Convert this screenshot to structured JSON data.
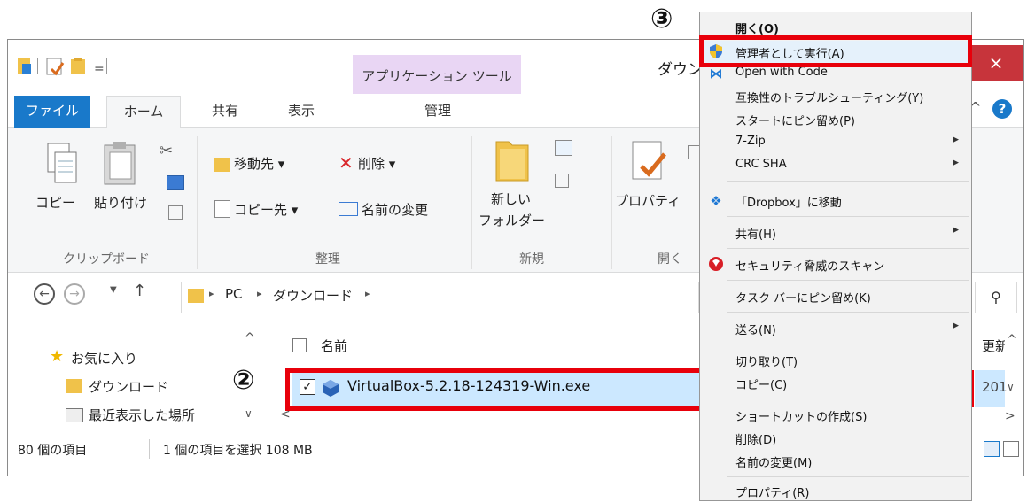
{
  "window": {
    "title": "ダウン",
    "context_tab": "アプリケーション ツール",
    "close": "×"
  },
  "tabs": {
    "file": "ファイル",
    "home": "ホーム",
    "share": "共有",
    "view": "表示",
    "manage": "管理"
  },
  "ribbon": {
    "clipboard": {
      "copy": "コピー",
      "paste": "貼り付け",
      "label": "クリップボード"
    },
    "organize": {
      "move_to": "移動先 ▾",
      "copy_to": "コピー先 ▾",
      "delete": "削除 ▾",
      "rename": "名前の変更",
      "label": "整理"
    },
    "new": {
      "new_folder_1": "新しい",
      "new_folder_2": "フォルダー",
      "label": "新規"
    },
    "open": {
      "properties": "プロパティ",
      "label": "開く"
    }
  },
  "address": {
    "pc": "PC",
    "downloads": "ダウンロード",
    "sep": "▸"
  },
  "nav": {
    "favorites": "お気に入り",
    "downloads": "ダウンロード",
    "recent": "最近表示した場所"
  },
  "file_list": {
    "header_name": "名前",
    "header_date": "更新",
    "file_name": "VirtualBox-5.2.18-124319-Win.exe",
    "date_partial": "201"
  },
  "status": {
    "item_count": "80 個の項目",
    "selected": "1 個の項目を選択  108 MB"
  },
  "markers": {
    "step2": "②",
    "step3": "③"
  },
  "menu": {
    "items": [
      {
        "label": "開く(O)"
      },
      {
        "label": "管理者として実行(A)"
      },
      {
        "label": "Open with Code"
      },
      {
        "label": "互換性のトラブルシューティング(Y)"
      },
      {
        "label": "スタートにピン留め(P)"
      },
      {
        "label": "7-Zip"
      },
      {
        "label": "CRC SHA"
      },
      {
        "label": "「Dropbox」に移動"
      },
      {
        "label": "共有(H)"
      },
      {
        "label": "セキュリティ脅威のスキャン"
      },
      {
        "label": "タスク バーにピン留め(K)"
      },
      {
        "label": "送る(N)"
      },
      {
        "label": "切り取り(T)"
      },
      {
        "label": "コピー(C)"
      },
      {
        "label": "ショートカットの作成(S)"
      },
      {
        "label": "削除(D)"
      },
      {
        "label": "名前の変更(M)"
      },
      {
        "label": "プロパティ(R)"
      }
    ]
  },
  "colors": {
    "accent": "#1979ca",
    "highlight": "#e8000b",
    "context_tab": "#e9d6f4",
    "selection": "#cce8ff",
    "close": "#c7343b"
  }
}
